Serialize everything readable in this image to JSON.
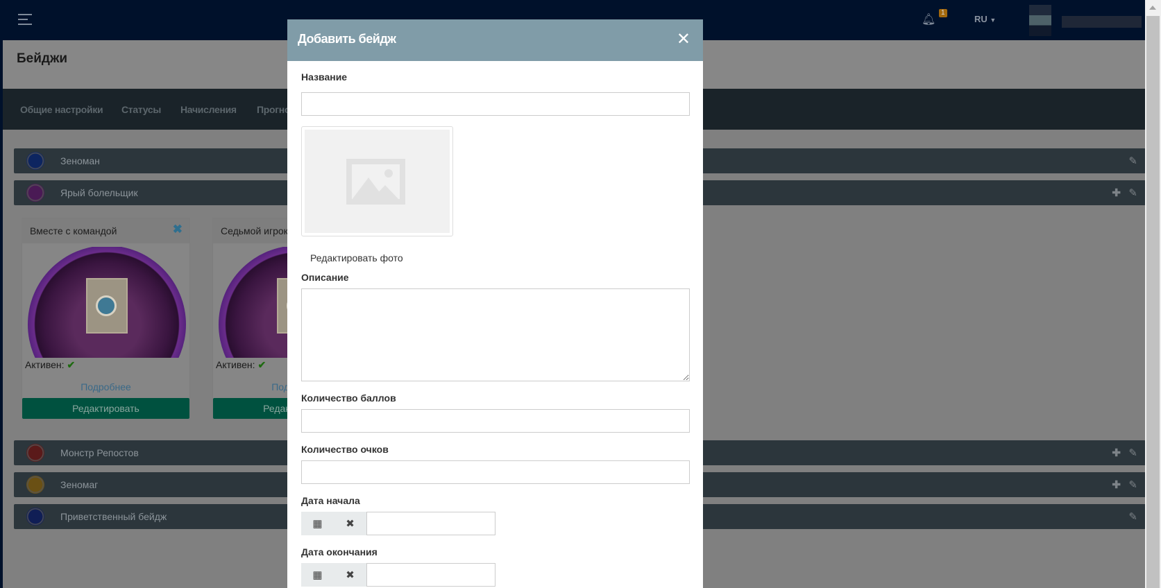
{
  "header": {
    "notifications_count": "1",
    "language": "RU"
  },
  "page": {
    "title": "Бейджи"
  },
  "tabs": [
    "Общие настройки",
    "Статусы",
    "Начисления",
    "Прогно"
  ],
  "badges": [
    {
      "name": "Зеноман",
      "icon_color": "#0d2560",
      "actions": [
        "edit"
      ]
    },
    {
      "name": "Ярый болельщик",
      "icon_color": "#4a1a55",
      "actions": [
        "add",
        "edit"
      ]
    },
    {
      "name": "Монстр Репостов",
      "icon_color": "#5a1a1a",
      "actions": [
        "add",
        "edit"
      ]
    },
    {
      "name": "Зеномаг",
      "icon_color": "#6a5014",
      "actions": [
        "add",
        "edit"
      ]
    },
    {
      "name": "Приветственный бейдж",
      "icon_color": "#101e55",
      "actions": [
        "edit"
      ]
    }
  ],
  "cards": [
    {
      "title": "Вместе с командой",
      "active_label": "Активен:",
      "more": "Подробнее",
      "edit": "Редактировать"
    },
    {
      "title": "Седьмой игрок",
      "active_label": "Активен:",
      "more": "Подробнее",
      "edit": "Редактировать"
    }
  ],
  "modal": {
    "title": "Добавить бейдж",
    "name_label": "Название",
    "name_value": "",
    "edit_photo": "Редактировать фото",
    "description_label": "Описание",
    "description_value": "",
    "points_label": "Количество баллов",
    "points_value": "",
    "score_label": "Количество очков",
    "score_value": "",
    "start_label": "Дата начала",
    "start_value": "",
    "end_label": "Дата окончания",
    "end_value": ""
  }
}
